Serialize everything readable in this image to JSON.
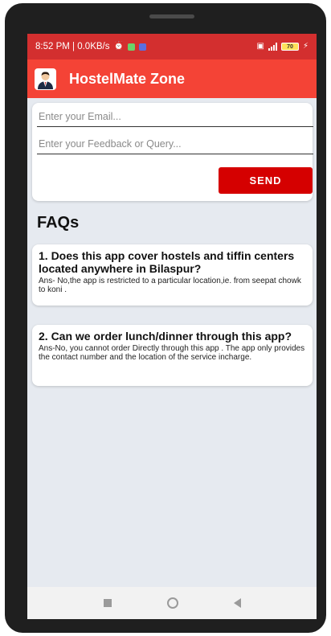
{
  "status_bar": {
    "time_info": "8:52 PM | 0.0KB/s",
    "battery_level": "70"
  },
  "app_bar": {
    "title": "HostelMate Zone",
    "logo_icon": "businessman-avatar-icon"
  },
  "feedback_form": {
    "email_placeholder": "Enter your Email...",
    "email_value": "",
    "feedback_placeholder": "Enter your Feedback or Query...",
    "feedback_value": "",
    "send_label": "SEND"
  },
  "faqs": {
    "heading": "FAQs",
    "items": [
      {
        "question": "1. Does this app cover hostels and tiffin centers located anywhere in Bilaspur?",
        "answer": "Ans- No,the app is restricted to a particular location,ie. from seepat chowk to koni ."
      },
      {
        "question": "2. Can we order lunch/dinner through this app?",
        "answer": "Ans-No, you cannot order Directly through this app . The app only provides the contact number and the location of the service incharge."
      }
    ]
  },
  "colors": {
    "status_bar": "#d32f2f",
    "app_bar": "#f44336",
    "send_button": "#d50000",
    "background": "#e6eaf0"
  }
}
